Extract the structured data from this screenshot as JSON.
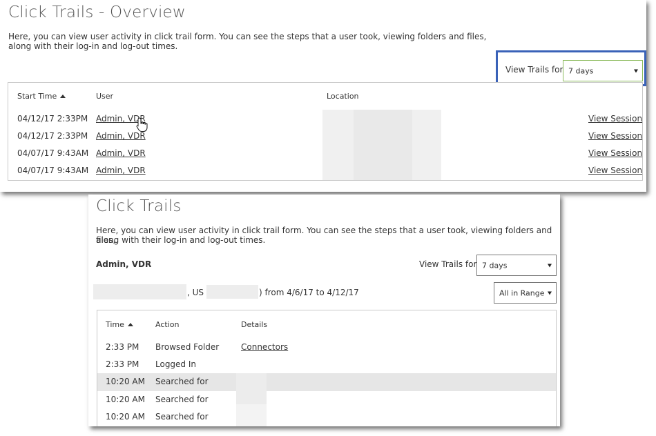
{
  "overview": {
    "title": "Click Trails - Overview",
    "desc_line1": "Here, you can view user activity in click trail form.  You can see the steps that a user took, viewing folders and files,",
    "desc_line2": "along with their log-in and log-out times.",
    "view_trails_label": "View Trails for:",
    "view_trails_value": "7 days",
    "accent": "#3a62b8",
    "select_border": "#8bbb5c",
    "columns": {
      "start_time": "Start Time",
      "user": "User",
      "location": "Location"
    },
    "rows": [
      {
        "time": "04/12/17 2:33PM",
        "user": "Admin, VDR",
        "action": "View Session"
      },
      {
        "time": "04/12/17 2:33PM",
        "user": "Admin, VDR",
        "action": "View Session"
      },
      {
        "time": "04/07/17 9:43AM",
        "user": "Admin, VDR",
        "action": "View Session"
      },
      {
        "time": "04/07/17 9:43AM",
        "user": "Admin, VDR",
        "action": "View Session"
      }
    ]
  },
  "detail": {
    "title": "Click Trails",
    "desc_line1": "Here, you can view user activity in click trail form.  You can see the steps that a user took, viewing folders and files,",
    "desc_line2": "along with their log-in and log-out times.",
    "user_name": "Admin, VDR",
    "view_trails_label": "View Trails for:",
    "view_trails_value": "7 days",
    "range_country": ", US (",
    "range_text": ") from 4/6/17 to 4/12/17",
    "range_filter_value": "All in Range",
    "columns": {
      "time": "Time",
      "action": "Action",
      "details": "Details"
    },
    "rows": [
      {
        "time": "2:33 PM",
        "action": "Browsed Folder",
        "details": "Connectors"
      },
      {
        "time": "2:33 PM",
        "action": "Logged In",
        "details": ""
      },
      {
        "time": "10:20 AM",
        "action": "Searched for",
        "details": ""
      },
      {
        "time": "10:20 AM",
        "action": "Searched for",
        "details": ""
      },
      {
        "time": "10:20 AM",
        "action": "Searched for",
        "details": ""
      }
    ]
  }
}
